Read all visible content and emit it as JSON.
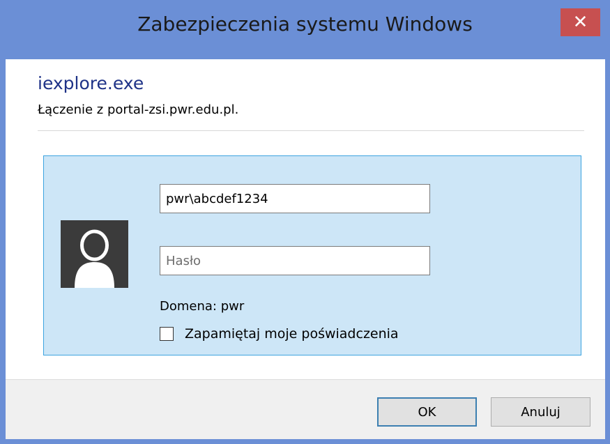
{
  "window": {
    "title": "Zabezpieczenia systemu Windows",
    "close_symbol": "✕"
  },
  "header": {
    "app_name": "iexplore.exe",
    "connection_text": "Łączenie z portal-zsi.pwr.edu.pl."
  },
  "credentials": {
    "avatar_icon": "user-avatar-icon",
    "username_value": "pwr\\abcdef1234",
    "password_placeholder": "Hasło",
    "domain_text": "Domena: pwr",
    "remember_label": "Zapamiętaj moje poświadczenia",
    "remember_checked": false
  },
  "buttons": {
    "ok_label": "OK",
    "cancel_label": "Anuluj"
  },
  "colors": {
    "titlebar": "#6b8fd6",
    "close_button": "#c75050",
    "app_name": "#1e3287",
    "panel_background": "#cde6f7",
    "panel_border": "#3ca4e0",
    "default_button_border": "#3c7fb1"
  }
}
